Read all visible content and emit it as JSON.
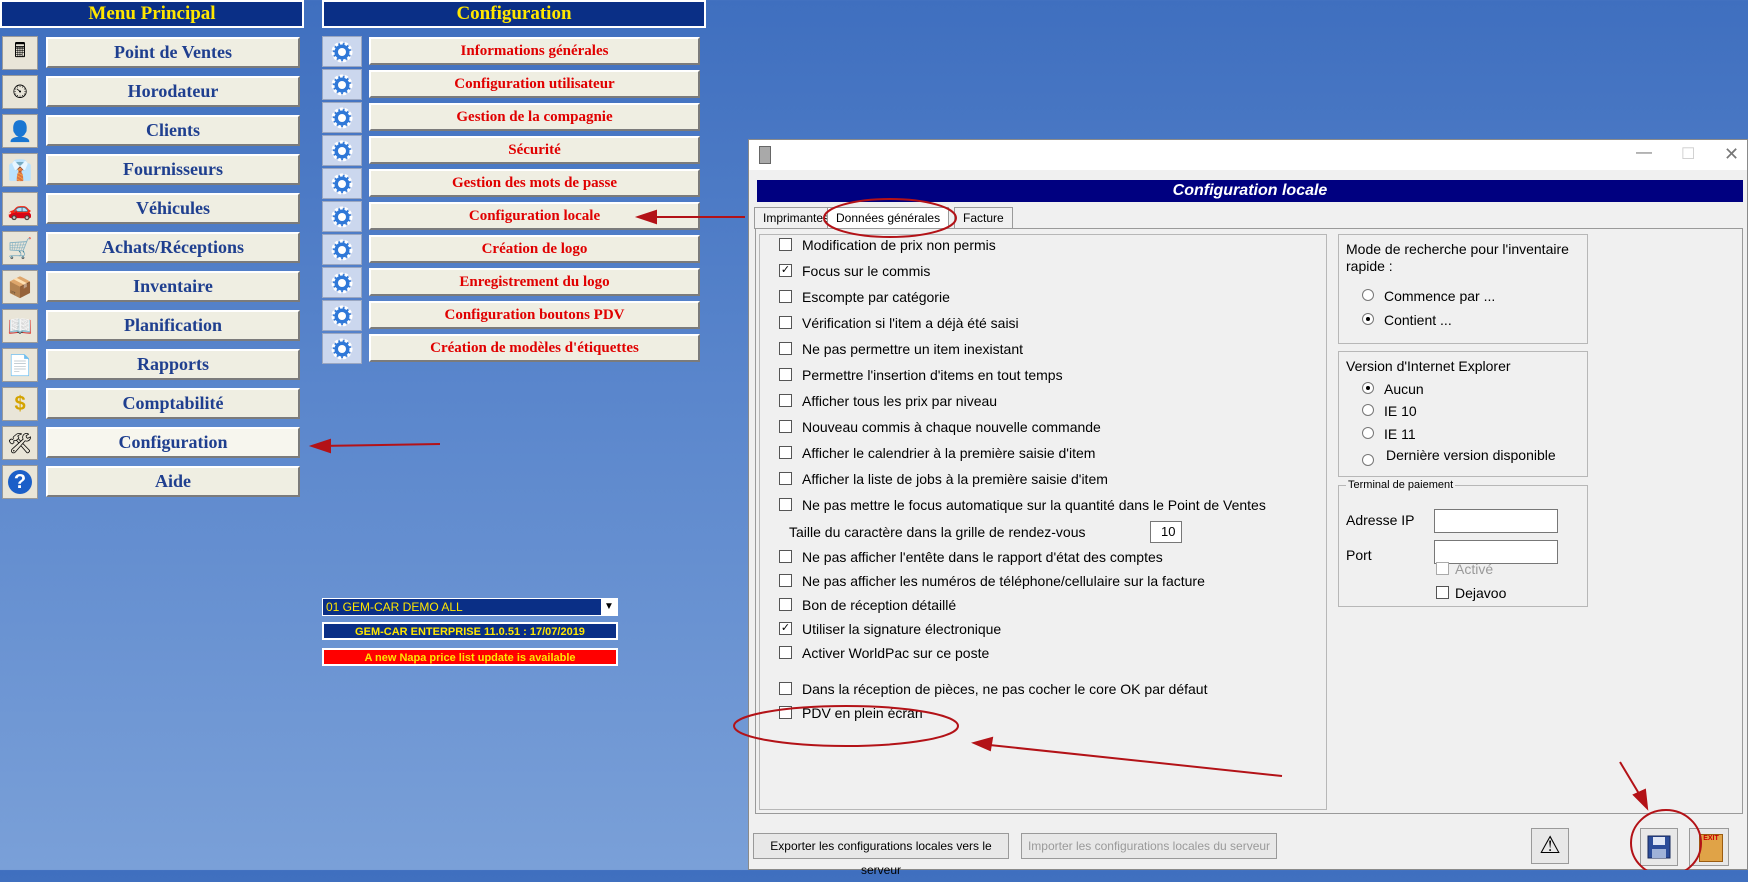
{
  "menu_principal": {
    "title": "Menu Principal",
    "items": [
      {
        "label": "Point de Ventes",
        "icon": "cash-register-icon"
      },
      {
        "label": "Horodateur",
        "icon": "time-clock-icon"
      },
      {
        "label": "Clients",
        "icon": "person-icon"
      },
      {
        "label": "Fournisseurs",
        "icon": "supplier-person-icon"
      },
      {
        "label": "Véhicules",
        "icon": "car-icon"
      },
      {
        "label": "Achats/Réceptions",
        "icon": "cart-icon"
      },
      {
        "label": "Inventaire",
        "icon": "inventory-icon"
      },
      {
        "label": "Planification",
        "icon": "planning-icon"
      },
      {
        "label": "Rapports",
        "icon": "reports-icon"
      },
      {
        "label": "Comptabilité",
        "icon": "dollar-icon"
      },
      {
        "label": "Configuration",
        "icon": "tools-icon"
      },
      {
        "label": "Aide",
        "icon": "help-icon"
      }
    ]
  },
  "configuration_menu": {
    "title": "Configuration",
    "items": [
      "Informations générales",
      "Configuration utilisateur",
      "Gestion de la compagnie",
      "Sécurité",
      "Gestion des mots de passe",
      "Configuration locale",
      "Création de logo",
      "Enregistrement du logo",
      "Configuration boutons PDV",
      "Création de modèles d'étiquettes"
    ]
  },
  "status": {
    "company_select": "01 GEM-CAR DEMO ALL",
    "version": "GEM-CAR ENTERPRISE 11.0.51 : 17/07/2019",
    "notice": "A new Napa price list update is available"
  },
  "dialog": {
    "header": "Configuration locale",
    "tabs": [
      "Imprimantes",
      "Données générales",
      "Facture"
    ],
    "checkboxes": [
      {
        "label": "Modification de prix non permis",
        "checked": false
      },
      {
        "label": "Focus sur le commis",
        "checked": true
      },
      {
        "label": "Escompte par catégorie",
        "checked": false
      },
      {
        "label": "Vérification si l'item a déjà été saisi",
        "checked": false
      },
      {
        "label": "Ne pas permettre un item inexistant",
        "checked": false
      },
      {
        "label": "Permettre l'insertion d'items en tout temps",
        "checked": false
      },
      {
        "label": "Afficher tous les prix par niveau",
        "checked": false
      },
      {
        "label": "Nouveau commis à chaque nouvelle commande",
        "checked": false
      },
      {
        "label": "Afficher le calendrier à la première saisie d'item",
        "checked": false
      },
      {
        "label": "Afficher la liste de jobs à la première saisie d'item",
        "checked": false
      },
      {
        "label": "Ne pas mettre le focus automatique sur la quantité dans le Point de Ventes",
        "checked": false
      }
    ],
    "font_size_label": "Taille du caractère dans la grille de rendez-vous",
    "font_size_value": "10",
    "checkboxes2": [
      {
        "label": "Ne pas afficher l'entête dans le rapport d'état des comptes",
        "checked": false
      },
      {
        "label": "Ne pas afficher les numéros de téléphone/cellulaire sur la facture",
        "checked": false
      },
      {
        "label": "Bon de réception détaillé",
        "checked": false
      },
      {
        "label": "Utiliser la signature électronique",
        "checked": true
      },
      {
        "label": "Activer WorldPac sur ce poste",
        "checked": false
      }
    ],
    "checkboxes3": [
      {
        "label": "Dans la réception de pièces, ne pas cocher le core OK par défaut",
        "checked": false
      },
      {
        "label": "PDV en plein écran",
        "checked": false
      }
    ],
    "search_mode": {
      "title": "Mode de recherche pour l'inventaire rapide :",
      "options": [
        {
          "label": "Commence par ...",
          "selected": false
        },
        {
          "label": "Contient ...",
          "selected": true
        }
      ]
    },
    "ie_version": {
      "title": "Version d'Internet Explorer",
      "options": [
        {
          "label": "Aucun",
          "selected": true
        },
        {
          "label": "IE 10",
          "selected": false
        },
        {
          "label": "IE 11",
          "selected": false
        },
        {
          "label": "Dernière version disponible",
          "selected": false
        }
      ]
    },
    "terminal": {
      "title": "Terminal de paiement",
      "ip_label": "Adresse IP",
      "ip_value": "",
      "port_label": "Port",
      "port_value": "",
      "active_label": "Activé",
      "dejavoo_label": "Dejavoo"
    },
    "export_button": "Exporter les configurations locales vers le serveur",
    "import_button": "Importer les configurations locales du serveur",
    "exit_label": "EXIT"
  },
  "colors": {
    "menu_text": "#1f3f8f",
    "config_text": "#e00000",
    "title_bg": "#0a2f86",
    "title_text": "#ffe600",
    "annotation": "#b31217"
  }
}
